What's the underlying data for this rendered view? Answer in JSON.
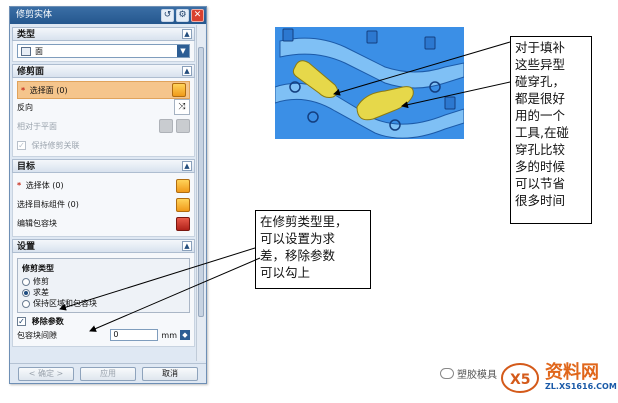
{
  "dialog": {
    "title": "修剪实体",
    "title_buttons": [
      "↺",
      "⚙",
      "✕"
    ],
    "type_section": {
      "header": "类型",
      "selected": "面"
    },
    "trim_face_section": {
      "header": "修剪面",
      "select_face": "选择面",
      "select_face_count": "(0)",
      "reverse": "反向",
      "inherit_label": "相对于平面",
      "keep_assoc": "保持修剪关联"
    },
    "target_section": {
      "header": "目标",
      "select_body": "选择体",
      "select_body_count": "(0)",
      "select_target_assembly": "选择目标组件",
      "select_target_assembly_count": "(0)",
      "edit_envelope": "编辑包容块"
    },
    "settings_section": {
      "header": "设置",
      "trim_type_label": "修剪类型",
      "options": [
        "修剪",
        "求差",
        "保持区域和包容块"
      ],
      "selected_option": "求差",
      "remove_params": "移除参数",
      "envelope_gap_label": "包容块间隙",
      "envelope_gap_value": "0",
      "unit": "mm"
    },
    "buttons": {
      "ok": "< 确定 >",
      "apply": "应用",
      "cancel": "取消"
    }
  },
  "annotations": {
    "right_callout": [
      "对于填补",
      "这些异型",
      "碰穿孔，",
      "都是很好",
      "用的一个",
      "工具,在碰",
      "穿孔比较",
      "多的时候",
      "可以节省",
      "很多时间"
    ],
    "mid_callout": [
      "在修剪类型里，",
      "可以设置为求",
      "差，移除参数",
      "可以勾上"
    ]
  },
  "watermark": {
    "wechat": "塑胶模具",
    "brand": "资料网",
    "url": "ZL.XS1616.COM"
  },
  "colors": {
    "title_bar": "#2f6399",
    "highlight": "#f5c58c",
    "render_blue": "#3b8fe6",
    "yellow_fill": "#e6d84a"
  }
}
